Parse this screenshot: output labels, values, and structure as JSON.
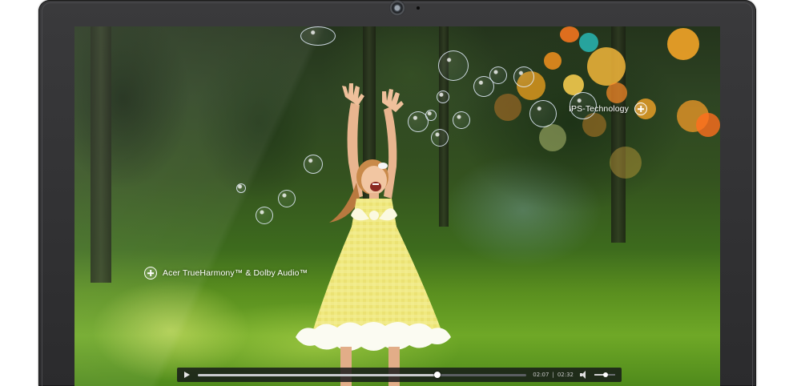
{
  "features": {
    "audio_label": "Acer TrueHarmony™ & Dolby Audio™",
    "display_label": "IPS-Technology"
  },
  "player": {
    "elapsed": "02:07",
    "separator": "|",
    "duration": "02:32",
    "progress_fraction": 0.73,
    "volume_fraction": 0.55
  },
  "colors": {
    "bezel": "#2f2f31",
    "grass": "#6fa827",
    "dress": "#f2ec8a",
    "bokeh_orange": "#f5a623"
  }
}
